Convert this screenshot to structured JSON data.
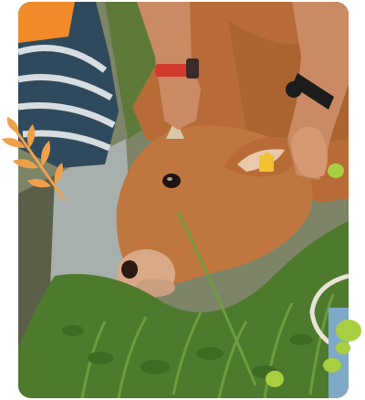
{
  "photo": {
    "subject": "cow-lying-on-grass",
    "colors": {
      "cow": "#c0773f",
      "cow_dark": "#9a5628",
      "grass": "#4e7a2e",
      "concrete": "#9aa3a3",
      "shirt_stripe_dark": "#2f4a5c",
      "shirt_stripe_light": "#d7dde0",
      "orange_shirt": "#f08a2a",
      "skin": "#c98a64",
      "watch_red": "#d23b2b",
      "watch_black": "#1c1c1c",
      "ear_tag": "#f2c230"
    }
  },
  "decorations": {
    "leaf_color": "#f0a04b",
    "dot_color": "#a8cf3f"
  }
}
